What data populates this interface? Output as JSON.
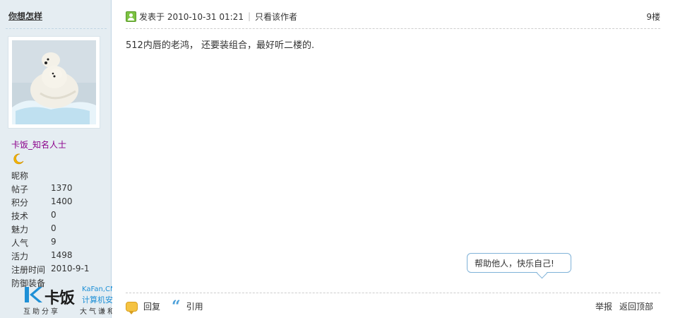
{
  "user": {
    "name": "你想怎样",
    "rank": "卡饭_知名人士",
    "nickname_label": "昵称",
    "stats": [
      {
        "label": "帖子",
        "value": "1370"
      },
      {
        "label": "积分",
        "value": "1400"
      },
      {
        "label": "技术",
        "value": "0"
      },
      {
        "label": "魅力",
        "value": "0"
      },
      {
        "label": "人气",
        "value": "9"
      },
      {
        "label": "活力",
        "value": "1498"
      },
      {
        "label": "注册时间",
        "value": "2010-9-1"
      },
      {
        "label": "防御装备",
        "value": ""
      }
    ]
  },
  "logo": {
    "cn": "卡饭",
    "en": "KaFan,CN",
    "slogan": "计算机安全",
    "sub1": "互助分享",
    "sub2": "大气谦和"
  },
  "post": {
    "time": "发表于 2010-10-31 01:21",
    "only_author": "只看该作者",
    "floor": "9楼",
    "content": "512内唇的老鸿， 还要装组合，最好听二楼的."
  },
  "tip": "帮助他人，快乐自己!",
  "actions": {
    "reply": "回复",
    "quote": "引用",
    "report": "举报",
    "back_top": "返回顶部"
  },
  "icons": [
    "online-icon",
    "moon-icon",
    "reply-icon",
    "quote-icon"
  ],
  "colors": {
    "rank": "#8b008b",
    "sidebar_bg": "#e5edf2",
    "logo_blue": "#1e90d6"
  }
}
